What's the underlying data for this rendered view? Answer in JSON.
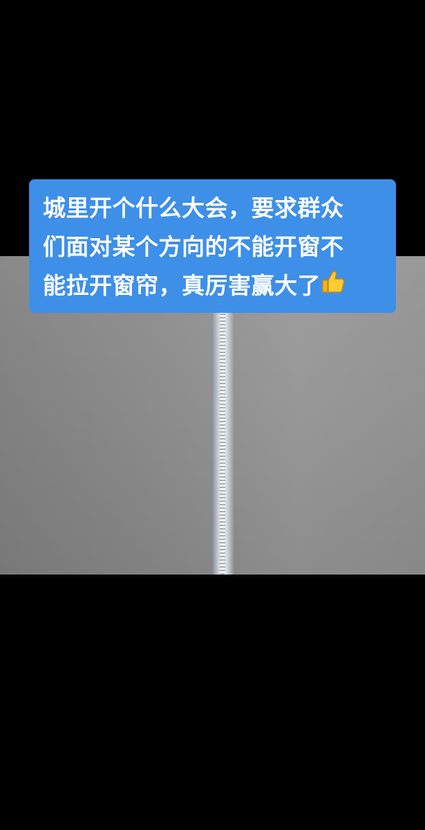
{
  "video": {
    "caption_lines": [
      "城里开个什么大会，要求群众",
      "们面对某个方向的不能开窗不",
      "能拉开窗帘，真厉害赢大了"
    ],
    "caption_emoji": "thumbs-up-icon"
  },
  "colors": {
    "caption_background": "#3e8fe8",
    "caption_text": "#ffffff",
    "letterbox": "#000000"
  }
}
